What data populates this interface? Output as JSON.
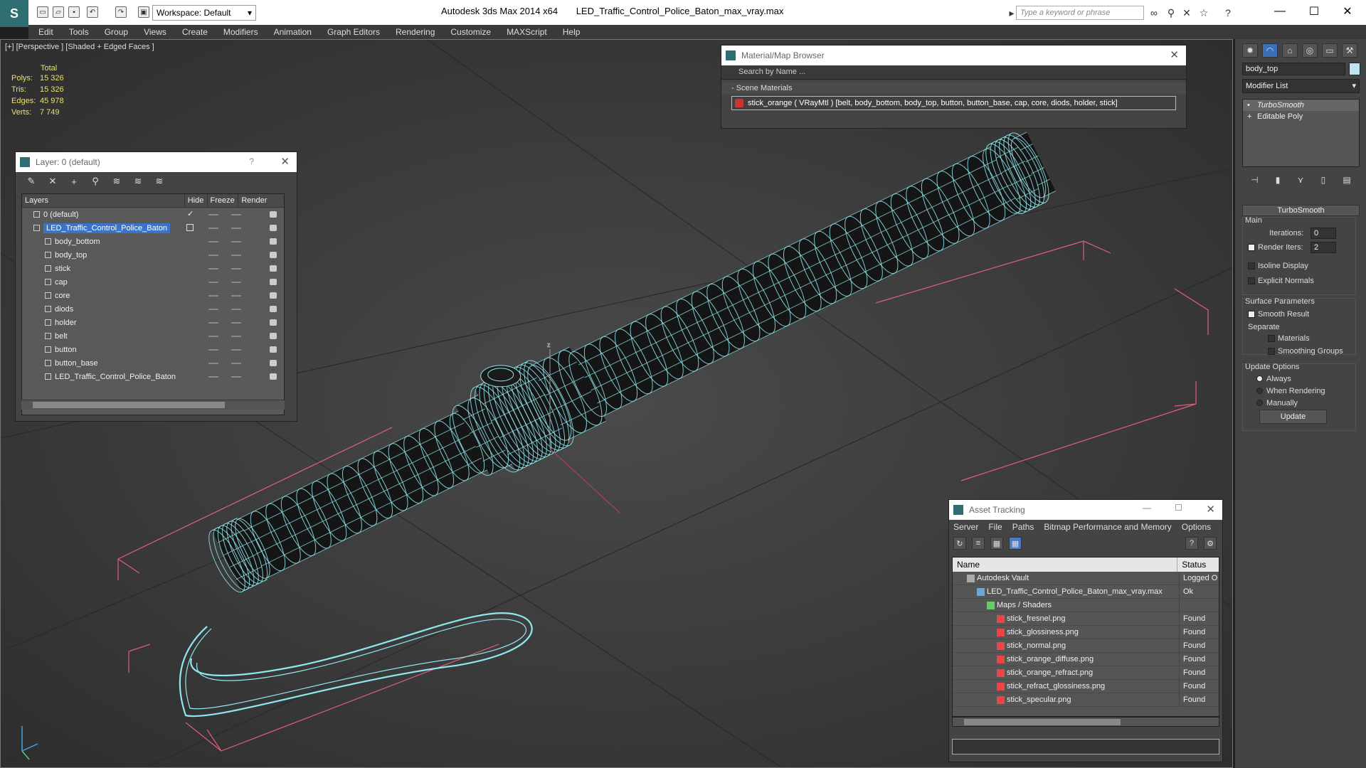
{
  "titlebar": {
    "workspace_label": "Workspace: Default",
    "app_name": "Autodesk 3ds Max  2014 x64",
    "file_name": "LED_Traffic_Control_Police_Baton_max_vray.max",
    "search_placeholder": "Type a keyword or phrase"
  },
  "menu": [
    "Edit",
    "Tools",
    "Group",
    "Views",
    "Create",
    "Modifiers",
    "Animation",
    "Graph Editors",
    "Rendering",
    "Customize",
    "MAXScript",
    "Help"
  ],
  "viewport": {
    "label": "[+] [Perspective ] [Shaded + Edged Faces ]",
    "stats": {
      "header": "Total",
      "rows": [
        {
          "label": "Polys:",
          "value": "15 326"
        },
        {
          "label": "Tris:",
          "value": "15 326"
        },
        {
          "label": "Edges:",
          "value": "45 978"
        },
        {
          "label": "Verts:",
          "value": "7 749"
        }
      ]
    },
    "wire_color": "#8fe8ef",
    "bbox_color": "#e0607a"
  },
  "layer_panel": {
    "title": "Layer: 0 (default)",
    "help": "?",
    "columns": [
      "Layers",
      "Hide",
      "Freeze",
      "Render"
    ],
    "rows": [
      {
        "name": "0 (default)",
        "level": 0,
        "checked": true
      },
      {
        "name": "LED_Traffic_Control_Police_Baton",
        "level": 0,
        "selected": true
      },
      {
        "name": "body_bottom",
        "level": 1
      },
      {
        "name": "body_top",
        "level": 1
      },
      {
        "name": "stick",
        "level": 1
      },
      {
        "name": "cap",
        "level": 1
      },
      {
        "name": "core",
        "level": 1
      },
      {
        "name": "diods",
        "level": 1
      },
      {
        "name": "holder",
        "level": 1
      },
      {
        "name": "belt",
        "level": 1
      },
      {
        "name": "button",
        "level": 1
      },
      {
        "name": "button_base",
        "level": 1
      },
      {
        "name": "LED_Traffic_Control_Police_Baton",
        "level": 1
      }
    ]
  },
  "material_browser": {
    "title": "Material/Map Browser",
    "search_placeholder": "Search by Name ...",
    "section": "- Scene Materials",
    "item": "stick_orange ( VRayMtl ) [belt, body_bottom, body_top, button, button_base, cap, core, diods, holder, stick]"
  },
  "command_panel": {
    "object_name": "body_top",
    "modifier_list": "Modifier List",
    "stack": [
      "TurboSmooth",
      "Editable Poly"
    ],
    "rollout_title": "TurboSmooth",
    "main_label": "Main",
    "iterations_label": "Iterations:",
    "iterations_value": "0",
    "render_iters_label": "Render Iters:",
    "render_iters_value": "2",
    "isoline_label": "Isoline Display",
    "explicit_label": "Explicit Normals",
    "surface_label": "Surface Parameters",
    "smooth_label": "Smooth Result",
    "separate_label": "Separate",
    "materials_label": "Materials",
    "smoothing_label": "Smoothing Groups",
    "update_options_label": "Update Options",
    "always_label": "Always",
    "when_rendering_label": "When Rendering",
    "manually_label": "Manually",
    "update_button": "Update"
  },
  "asset_tracking": {
    "title": "Asset Tracking",
    "menu": [
      "Server",
      "File",
      "Paths",
      "Bitmap Performance and Memory",
      "Options"
    ],
    "columns": [
      "Name",
      "Status"
    ],
    "rows": [
      {
        "name": "Autodesk Vault",
        "status": "Logged O",
        "indent": 34,
        "icon": "vault-icon"
      },
      {
        "name": "LED_Traffic_Control_Police_Baton_max_vray.max",
        "status": "Ok",
        "indent": 48,
        "icon": "max-file-icon"
      },
      {
        "name": "Maps / Shaders",
        "status": "",
        "indent": 62,
        "icon": "maps-icon"
      },
      {
        "name": "stick_fresnel.png",
        "status": "Found",
        "indent": 76,
        "icon": "png-icon"
      },
      {
        "name": "stick_glossiness.png",
        "status": "Found",
        "indent": 76,
        "icon": "png-icon"
      },
      {
        "name": "stick_normal.png",
        "status": "Found",
        "indent": 76,
        "icon": "png-icon"
      },
      {
        "name": "stick_orange_diffuse.png",
        "status": "Found",
        "indent": 76,
        "icon": "png-icon"
      },
      {
        "name": "stick_orange_refract.png",
        "status": "Found",
        "indent": 76,
        "icon": "png-icon"
      },
      {
        "name": "stick_refract_glossiness.png",
        "status": "Found",
        "indent": 76,
        "icon": "png-icon"
      },
      {
        "name": "stick_specular.png",
        "status": "Found",
        "indent": 76,
        "icon": "png-icon"
      }
    ]
  }
}
